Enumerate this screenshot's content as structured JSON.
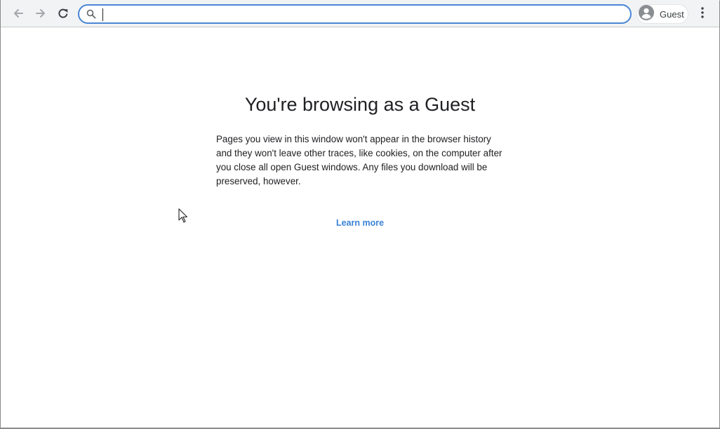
{
  "toolbar": {
    "back_icon": "arrow-back-icon",
    "forward_icon": "arrow-forward-icon",
    "reload_icon": "reload-icon",
    "omnibox": {
      "value": "",
      "icon": "search-icon",
      "accent_color": "#4a86d6"
    },
    "profile": {
      "label": "Guest",
      "icon": "avatar-icon"
    },
    "menu_icon": "kebab-menu-icon"
  },
  "page": {
    "title": "You're browsing as a Guest",
    "body": "Pages you view in this window won't appear in the browser history and they won't leave other traces, like cookies, on the computer after you close all open Guest windows. Any files you download will be preserved, however.",
    "link": "Learn more",
    "link_color": "#3b82d4"
  }
}
